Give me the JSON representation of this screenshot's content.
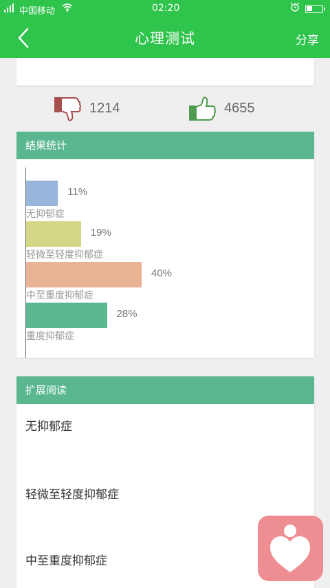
{
  "status_bar": {
    "carrier": "中国移动",
    "time": "02:20",
    "signal_icon": "signal-icon",
    "wifi_icon": "wifi-icon",
    "alarm_icon": "alarm-icon",
    "battery_icon": "battery-icon"
  },
  "nav": {
    "title": "心理测试",
    "share_label": "分享",
    "back_icon": "chevron-left-icon"
  },
  "votes": {
    "dislike_count": "1214",
    "like_count": "4655",
    "dislike_icon": "thumbs-down-icon",
    "like_icon": "thumbs-up-icon"
  },
  "stats_panel": {
    "title": "结果统计"
  },
  "chart_data": {
    "type": "bar",
    "orientation": "horizontal",
    "categories": [
      "无抑郁症",
      "轻微至轻度抑郁症",
      "中至重度抑郁症",
      "重度抑郁症"
    ],
    "values": [
      11,
      19,
      40,
      28
    ],
    "value_labels": [
      "11%",
      "19%",
      "40%",
      "28%"
    ],
    "colors": [
      "#98b5dc",
      "#d4d886",
      "#ebb396",
      "#5ab790"
    ],
    "xlim": [
      0,
      100
    ],
    "legend": "none",
    "grid": false
  },
  "reading_panel": {
    "title": "扩展阅读",
    "items": [
      "无抑郁症",
      "轻微至轻度抑郁症",
      "中至重度抑郁症"
    ]
  },
  "fab": {
    "icon": "heart-person-icon",
    "color": "#ee8e93"
  },
  "colors": {
    "primary_green": "#2fc44b",
    "panel_header": "#5ab790"
  }
}
